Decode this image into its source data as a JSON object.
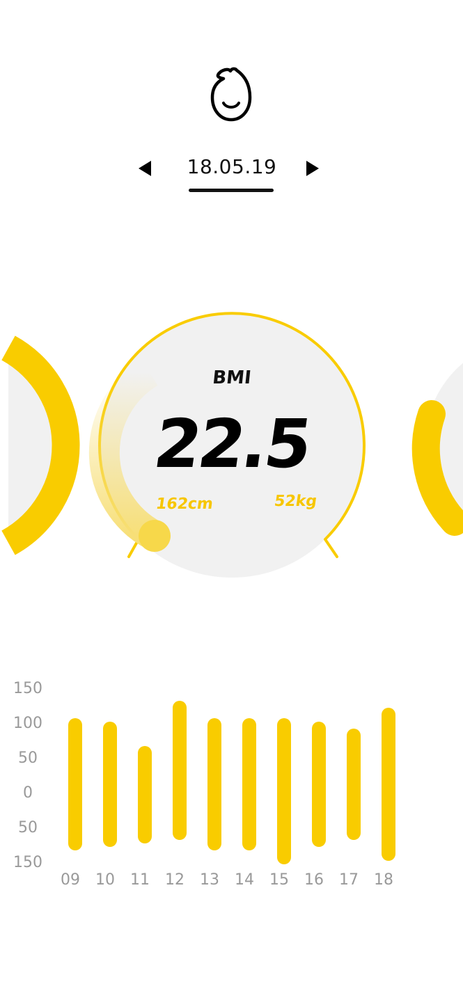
{
  "header": {
    "avatar_icon": "baby-face-icon",
    "date": "18.05.19",
    "prev_icon": "triangle-left-icon",
    "next_icon": "triangle-right-icon"
  },
  "bmi_card": {
    "label": "BMI",
    "value": "22.5",
    "height": "162cm",
    "weight": "52kg"
  },
  "colors": {
    "accent": "#f9cc00",
    "accent_light": "#f7df78",
    "card_bg": "#f1f1f1",
    "tick_text": "#999999",
    "text": "#111111"
  },
  "chart_data": {
    "type": "bar",
    "y_tick_labels": [
      "150",
      "100",
      "50",
      "0",
      "50",
      "150"
    ],
    "categories": [
      "09",
      "10",
      "11",
      "12",
      "13",
      "14",
      "15",
      "16",
      "17",
      "18"
    ],
    "series": [
      {
        "top": [
          105,
          100,
          65,
          130,
          105,
          105,
          105,
          100,
          90,
          120
        ],
        "bottom": [
          -85,
          -80,
          -75,
          -70,
          -85,
          -85,
          -105,
          -80,
          -70,
          -100
        ]
      }
    ],
    "ylim": [
      -150,
      150
    ]
  }
}
